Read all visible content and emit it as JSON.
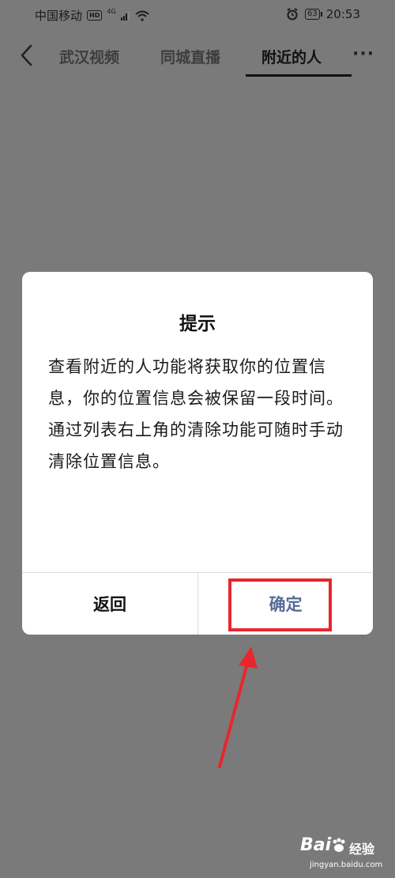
{
  "status_bar": {
    "carrier": "中国移动",
    "hd": "HD",
    "network": "4G",
    "battery": "63",
    "time": "20:53"
  },
  "nav": {
    "tabs": [
      {
        "label": "武汉视频",
        "active": false
      },
      {
        "label": "同城直播",
        "active": false
      },
      {
        "label": "附近的人",
        "active": true
      }
    ],
    "more": "···"
  },
  "dialog": {
    "title": "提示",
    "body": "查看附近的人功能将获取你的位置信息，你的位置信息会被保留一段时间。通过列表右上角的清除功能可随时手动清除位置信息。",
    "back_label": "返回",
    "confirm_label": "确定"
  },
  "watermark": {
    "logo": "Bai",
    "text": "经验",
    "url": "jingyan.baidu.com"
  },
  "colors": {
    "overlay": "#7a7a7a",
    "confirm_text": "#576b95",
    "annotation_red": "#e8262d"
  }
}
